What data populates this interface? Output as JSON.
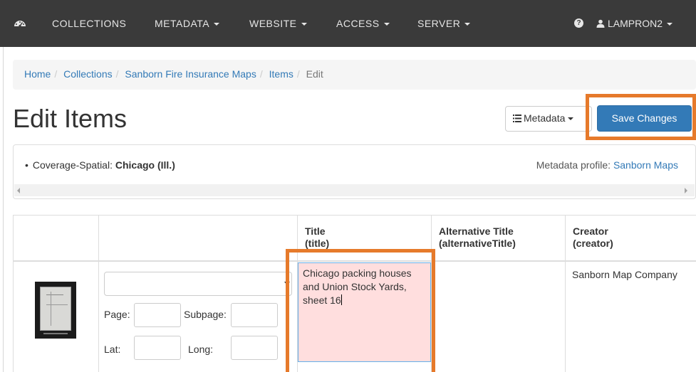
{
  "navbar": {
    "items": [
      {
        "label": "COLLECTIONS",
        "dropdown": false
      },
      {
        "label": "METADATA",
        "dropdown": true
      },
      {
        "label": "WEBSITE",
        "dropdown": true
      },
      {
        "label": "ACCESS",
        "dropdown": true
      },
      {
        "label": "SERVER",
        "dropdown": true
      }
    ],
    "help_icon": "?",
    "user": "LAMPRON2"
  },
  "breadcrumb": {
    "items": [
      "Home",
      "Collections",
      "Sanborn Fire Insurance Maps",
      "Items"
    ],
    "active": "Edit",
    "separator": "/"
  },
  "page": {
    "title": "Edit Items"
  },
  "toolbar": {
    "metadata_label": "Metadata",
    "save_label": "Save Changes"
  },
  "info": {
    "coverage_label": "Coverage-Spatial:",
    "coverage_value": "Chicago (Ill.)",
    "profile_label": "Metadata profile:",
    "profile_value": "Sanborn Maps"
  },
  "table": {
    "columns": [
      {
        "title": "Title",
        "field": "(title)"
      },
      {
        "title": "Alternative Title",
        "field": "(alternativeTitle)"
      },
      {
        "title": "Creator",
        "field": "(creator)"
      }
    ],
    "row": {
      "page_label": "Page:",
      "subpage_label": "Subpage:",
      "lat_label": "Lat:",
      "long_label": "Long:",
      "title_value": "Chicago packing houses and Union Stock Yards, sheet 16",
      "alternative_title_value": "",
      "creator_value": "Sanborn Map Company"
    }
  },
  "colors": {
    "navbar_bg": "#3a3a3a",
    "primary": "#337ab7",
    "highlight": "#e67a2b",
    "edited_cell": "#ffdede"
  }
}
